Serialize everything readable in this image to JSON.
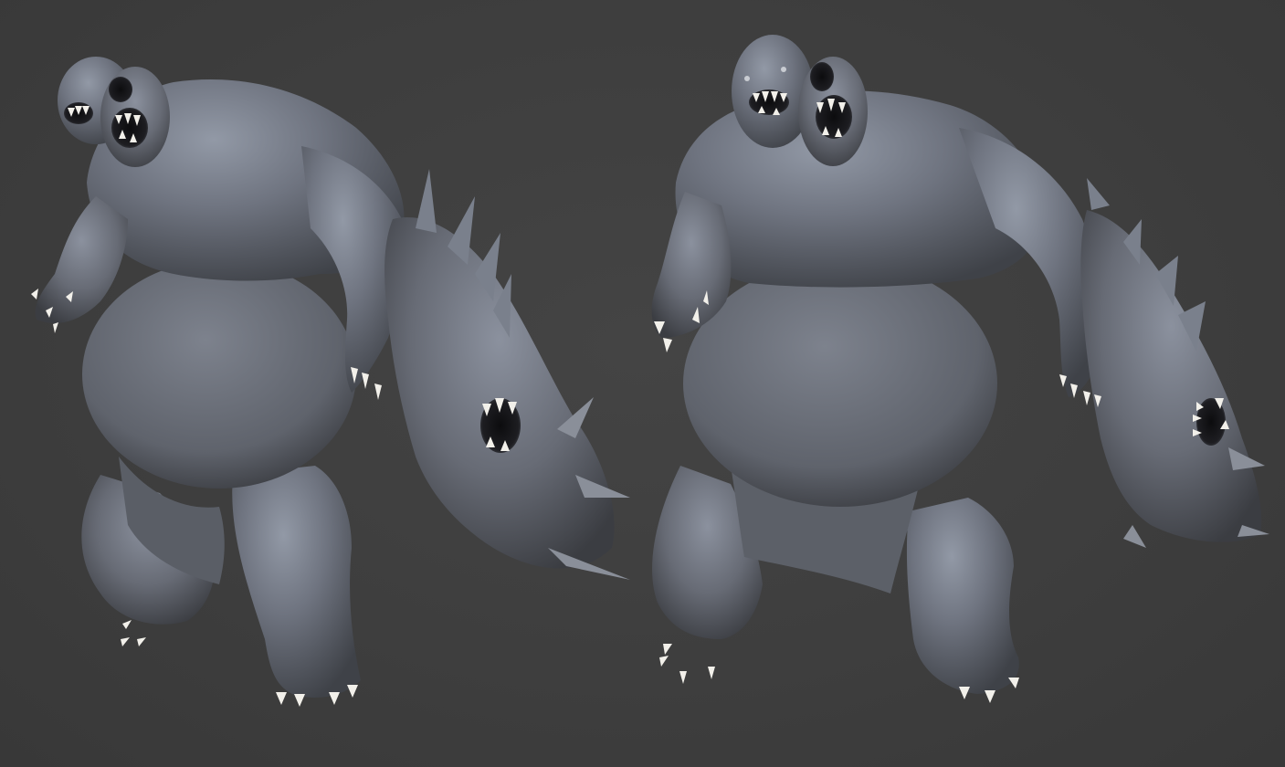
{
  "scene": {
    "background_color": "#3d3d3d",
    "model_color": "#6e727c",
    "highlight_color": "#9aa3b4",
    "shadow_color": "#2c2e33",
    "tooth_color": "#f2f0ea",
    "views": [
      {
        "name": "creature-view-angled",
        "icon": "sculpt-creature"
      },
      {
        "name": "creature-view-front",
        "icon": "sculpt-creature"
      }
    ]
  }
}
